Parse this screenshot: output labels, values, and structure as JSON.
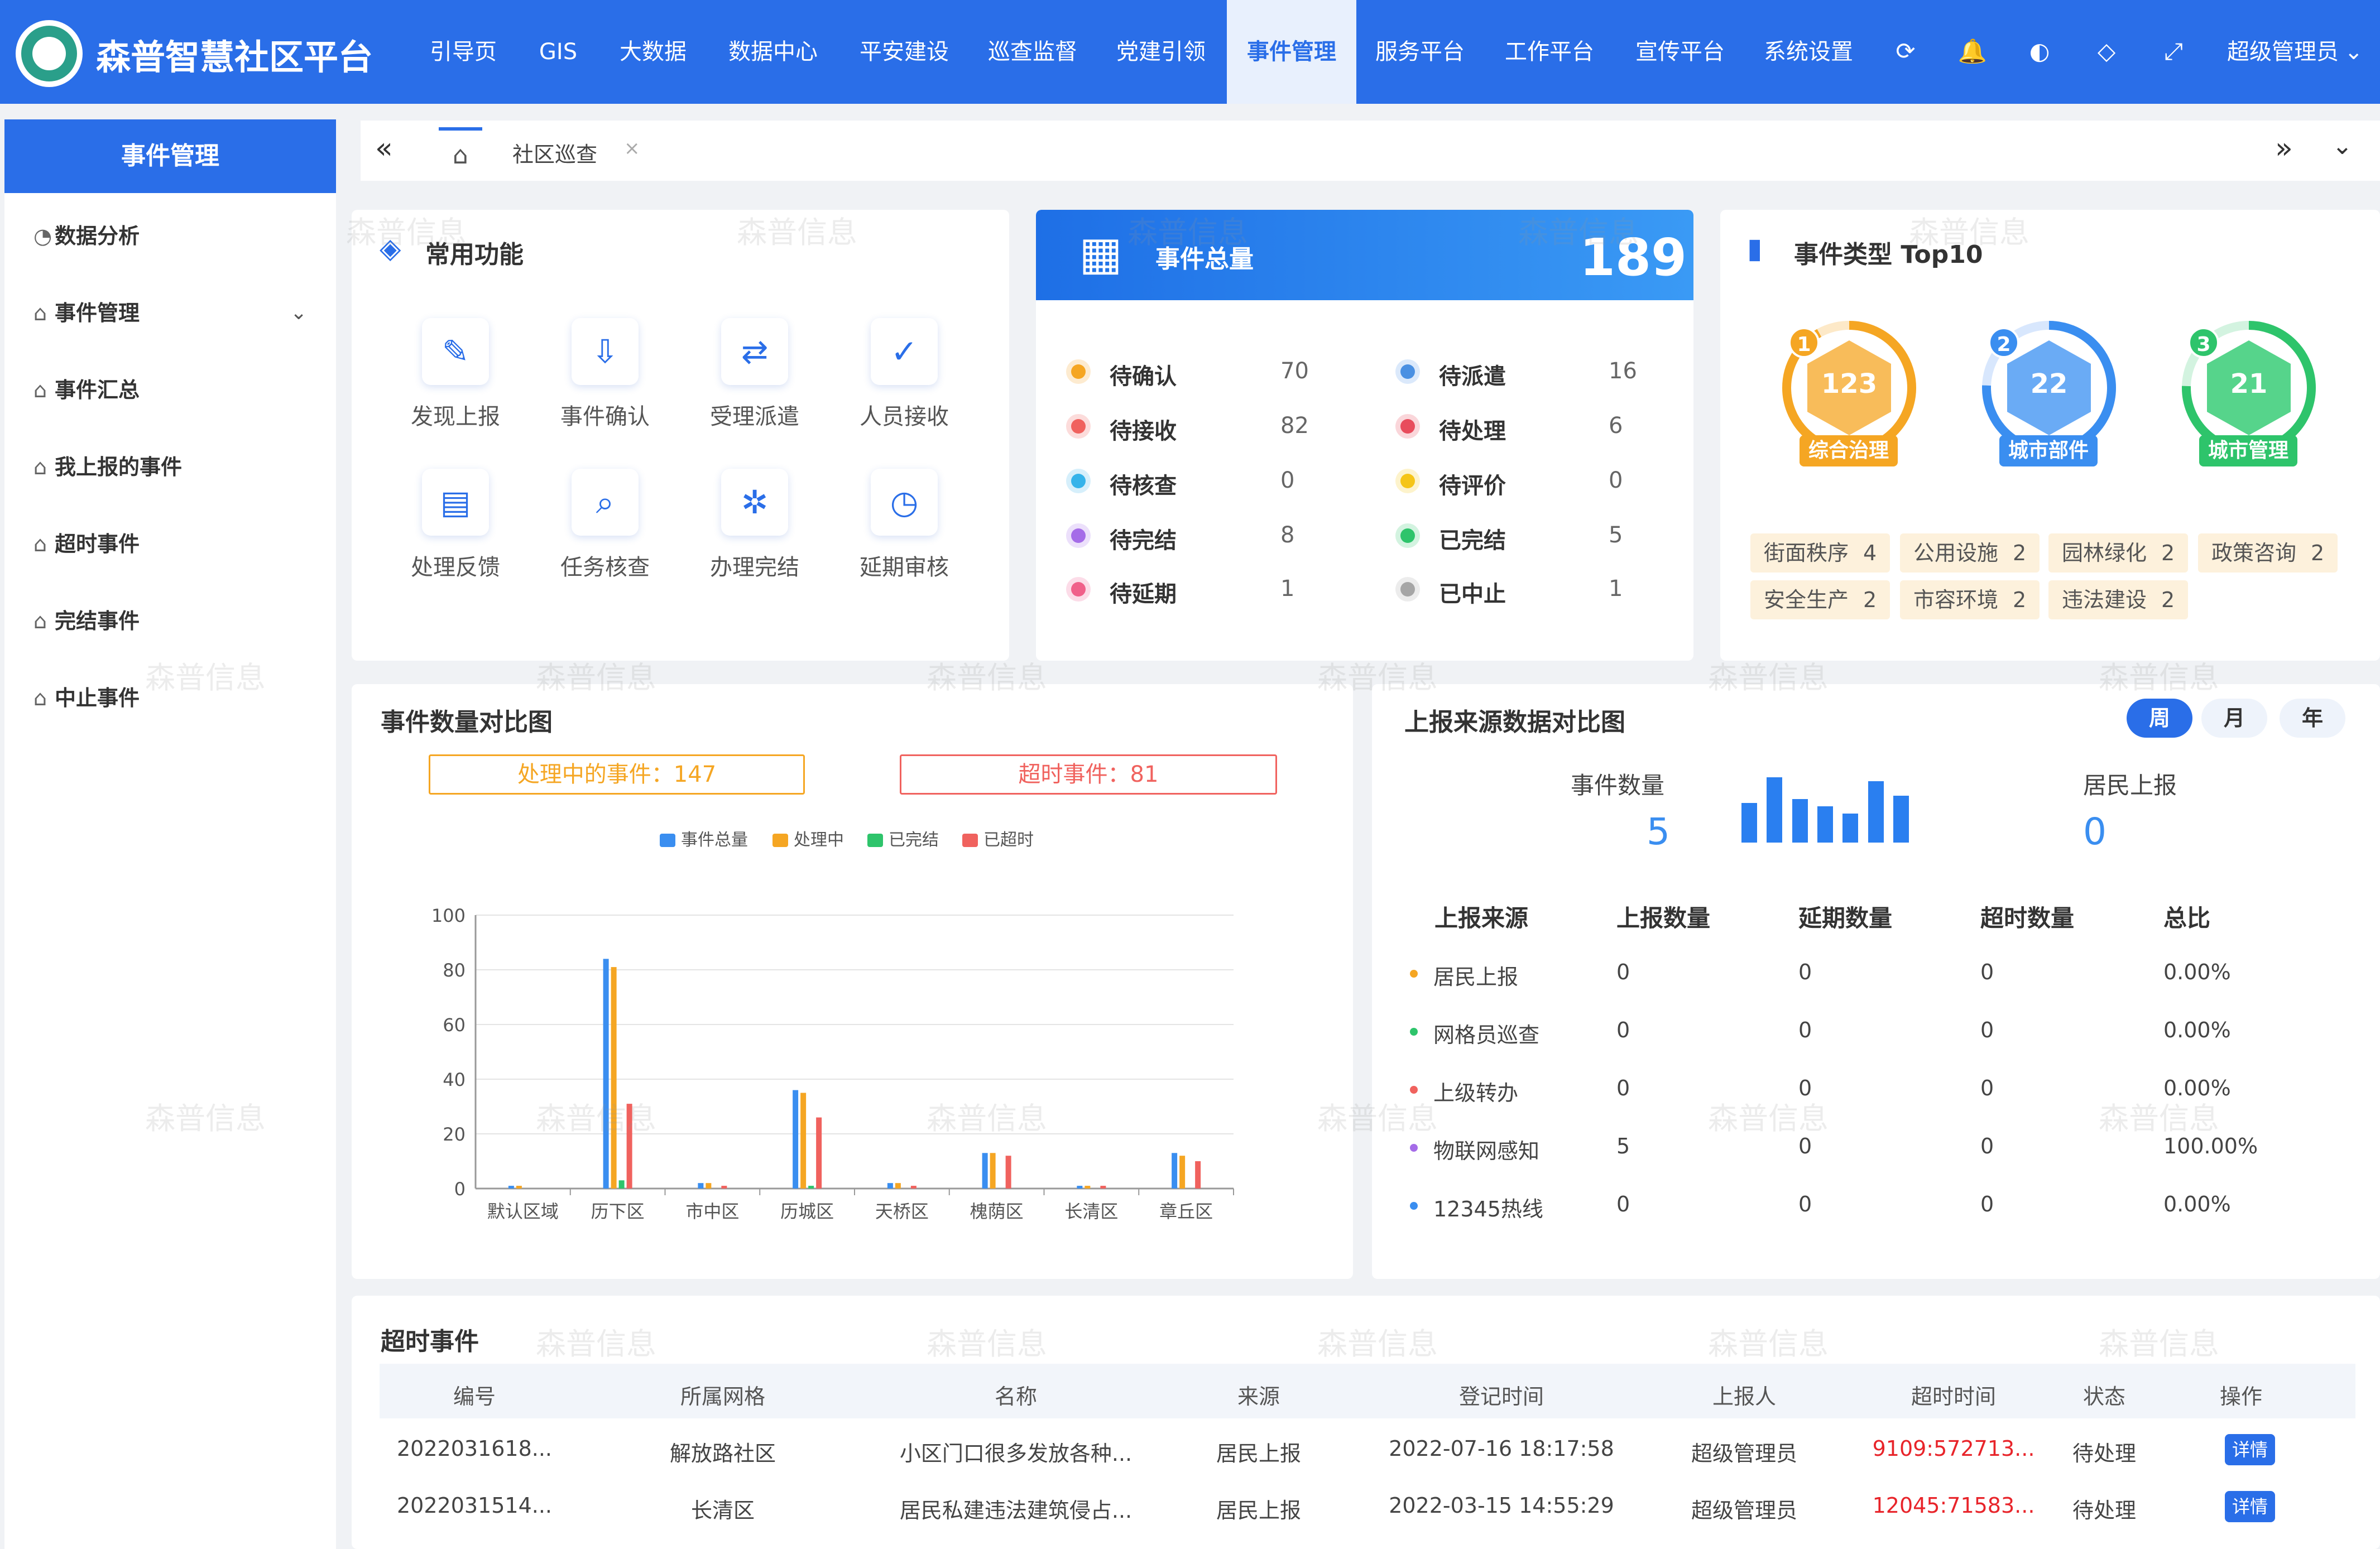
{
  "header": {
    "title": "森普智慧社区平台",
    "nav": [
      {
        "label": "引导页",
        "active": false
      },
      {
        "label": "GIS",
        "active": false
      },
      {
        "label": "大数据",
        "active": false
      },
      {
        "label": "数据中心",
        "active": false
      },
      {
        "label": "平安建设",
        "active": false
      },
      {
        "label": "巡查监督",
        "active": false
      },
      {
        "label": "党建引领",
        "active": false
      },
      {
        "label": "事件管理",
        "active": true
      },
      {
        "label": "服务平台",
        "active": false
      },
      {
        "label": "工作平台",
        "active": false
      },
      {
        "label": "宣传平台",
        "active": false
      },
      {
        "label": "系统设置",
        "active": false
      }
    ],
    "icons": [
      "refresh-icon",
      "bell-icon",
      "palette-icon",
      "tag-icon",
      "fullscreen-icon"
    ],
    "user": "超级管理员"
  },
  "sidebar": {
    "title": "事件管理",
    "items": [
      {
        "label": "数据分析"
      },
      {
        "label": "事件管理"
      },
      {
        "label": "事件汇总"
      },
      {
        "label": "我上报的事件"
      },
      {
        "label": "超时事件"
      },
      {
        "label": "完结事件"
      },
      {
        "label": "中止事件"
      }
    ]
  },
  "tabs": {
    "current": "社区巡查",
    "close": "×"
  },
  "common": {
    "title": "常用功能",
    "items": [
      {
        "label": "发现上报",
        "icon": "pencil-icon"
      },
      {
        "label": "事件确认",
        "icon": "inbox-icon"
      },
      {
        "label": "受理派遣",
        "icon": "dispatch-icon"
      },
      {
        "label": "人员接收",
        "icon": "file-check-icon"
      },
      {
        "label": "处理反馈",
        "icon": "report-icon"
      },
      {
        "label": "任务核查",
        "icon": "search-doc-icon"
      },
      {
        "label": "办理完结",
        "icon": "network-icon"
      },
      {
        "label": "延期审核",
        "icon": "clock-icon"
      }
    ]
  },
  "total": {
    "title": "事件总量",
    "value": "189",
    "statuses": [
      {
        "label": "待确认",
        "value": "70",
        "color": "#f5a623"
      },
      {
        "label": "待派遣",
        "value": "16",
        "color": "#4a90e2"
      },
      {
        "label": "待接收",
        "value": "82",
        "color": "#f0625e"
      },
      {
        "label": "待处理",
        "value": "6",
        "color": "#e84c5c"
      },
      {
        "label": "待核查",
        "value": "0",
        "color": "#35b3ea"
      },
      {
        "label": "待评价",
        "value": "0",
        "color": "#f5c518"
      },
      {
        "label": "待完结",
        "value": "8",
        "color": "#a56ce8"
      },
      {
        "label": "已完结",
        "value": "5",
        "color": "#2ec46b"
      },
      {
        "label": "待延期",
        "value": "1",
        "color": "#f0608a"
      },
      {
        "label": "已中止",
        "value": "1",
        "color": "#a6a6a6"
      }
    ]
  },
  "top10": {
    "title": "事件类型 Top10",
    "donuts": [
      {
        "rank": "1",
        "value": "123",
        "label": "综合治理",
        "color": "#f5a623"
      },
      {
        "rank": "2",
        "value": "22",
        "label": "城市部件",
        "color": "#3a8ef0"
      },
      {
        "rank": "3",
        "value": "21",
        "label": "城市管理",
        "color": "#2ec46b"
      }
    ],
    "tags": [
      {
        "name": "街面秩序",
        "count": "4"
      },
      {
        "name": "公用设施",
        "count": "2"
      },
      {
        "name": "园林绿化",
        "count": "2"
      },
      {
        "name": "政策咨询",
        "count": "2"
      },
      {
        "name": "安全生产",
        "count": "2"
      },
      {
        "name": "市容环境",
        "count": "2"
      },
      {
        "name": "违法建设",
        "count": "2"
      }
    ]
  },
  "compare": {
    "title": "事件数量对比图",
    "processing_label": "处理中的事件：147",
    "timeout_label": "超时事件：81"
  },
  "chart_data": {
    "type": "bar",
    "categories": [
      "默认区域",
      "历下区",
      "市中区",
      "历城区",
      "天桥区",
      "槐荫区",
      "长清区",
      "章丘区"
    ],
    "series": [
      {
        "name": "事件总量",
        "color": "#3a8ef0",
        "values": [
          1,
          84,
          2,
          36,
          2,
          13,
          1,
          13
        ]
      },
      {
        "name": "处理中",
        "color": "#f5a623",
        "values": [
          1,
          81,
          2,
          35,
          2,
          13,
          1,
          12
        ]
      },
      {
        "name": "已完结",
        "color": "#2ec46b",
        "values": [
          0,
          3,
          0,
          1,
          0,
          0,
          0,
          0
        ]
      },
      {
        "name": "已超时",
        "color": "#f0625e",
        "values": [
          0,
          31,
          1,
          26,
          1,
          12,
          1,
          10
        ]
      }
    ],
    "yticks": [
      "0",
      "20",
      "40",
      "60",
      "80",
      "100"
    ],
    "ylim": [
      0,
      100
    ],
    "legend": "top-center",
    "grid": true
  },
  "source": {
    "title": "上报来源数据对比图",
    "toggles": [
      {
        "label": "周",
        "active": true
      },
      {
        "label": "月",
        "active": false
      },
      {
        "label": "年",
        "active": false
      }
    ],
    "event_count_label": "事件数量",
    "event_count_value": "5",
    "resident_label": "居民上报",
    "resident_value": "0",
    "mini_bars": [
      0.55,
      0.9,
      0.6,
      0.5,
      0.4,
      0.85,
      0.65
    ],
    "headers": [
      "上报来源",
      "上报数量",
      "延期数量",
      "超时数量",
      "总比"
    ],
    "rows": [
      {
        "name": "居民上报",
        "report": "0",
        "delay": "0",
        "timeout": "0",
        "ratio": "0.00%",
        "color": "#f5a623"
      },
      {
        "name": "网格员巡查",
        "report": "0",
        "delay": "0",
        "timeout": "0",
        "ratio": "0.00%",
        "color": "#2ec46b"
      },
      {
        "name": "上级转办",
        "report": "0",
        "delay": "0",
        "timeout": "0",
        "ratio": "0.00%",
        "color": "#f0625e"
      },
      {
        "name": "物联网感知",
        "report": "5",
        "delay": "0",
        "timeout": "0",
        "ratio": "100.00%",
        "color": "#a56ce8"
      },
      {
        "name": "12345热线",
        "report": "0",
        "delay": "0",
        "timeout": "0",
        "ratio": "0.00%",
        "color": "#3a8ef0"
      }
    ]
  },
  "timeout_table": {
    "title": "超时事件",
    "headers": [
      "编号",
      "所属网格",
      "名称",
      "来源",
      "登记时间",
      "上报人",
      "超时时间",
      "状态",
      "操作"
    ],
    "rows": [
      {
        "id": "2022031618...",
        "grid": "解放路社区",
        "name": "小区门口很多发放各种...",
        "source": "居民上报",
        "time": "2022-07-16 18:17:58",
        "reporter": "超级管理员",
        "overtime": "9109:572713...",
        "status": "待处理",
        "action": "详情"
      },
      {
        "id": "2022031514...",
        "grid": "长清区",
        "name": "居民私建违法建筑侵占...",
        "source": "居民上报",
        "time": "2022-03-15 14:55:29",
        "reporter": "超级管理员",
        "overtime": "12045:71583...",
        "status": "待处理",
        "action": "详情"
      }
    ]
  },
  "watermark": "森普信息",
  "colors": {
    "primary": "#2a6ee8",
    "danger": "#e8242a",
    "warning": "#f5a623"
  }
}
